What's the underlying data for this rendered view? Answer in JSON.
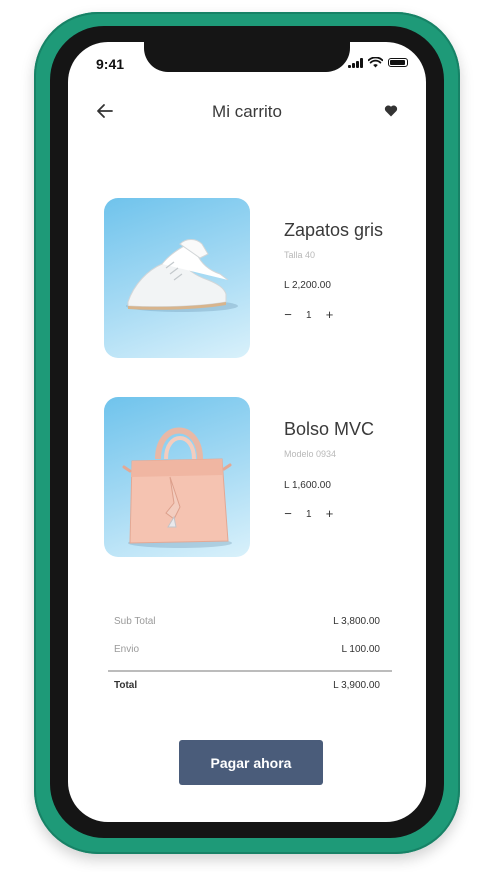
{
  "status_bar": {
    "time": "9:41"
  },
  "header": {
    "title": "Mi carrito",
    "back_icon": "arrow-left-icon",
    "fav_icon": "heart-icon"
  },
  "cart": {
    "items": [
      {
        "name": "Zapatos gris",
        "detail": "Talla 40",
        "price": "L 2,200.00",
        "quantity": "1",
        "image": "sneaker-image"
      },
      {
        "name": "Bolso MVC",
        "detail": "Modelo 0934",
        "price": "L 1,600.00",
        "quantity": "1",
        "image": "handbag-image"
      }
    ],
    "qty_minus": "−",
    "qty_plus": "+"
  },
  "summary": {
    "subtotal_label": "Sub Total",
    "subtotal_value": "L 3,800.00",
    "shipping_label": "Envio",
    "shipping_value": "L 100.00",
    "total_label": "Total",
    "total_value": "L 3,900.00"
  },
  "checkout": {
    "button_label": "Pagar ahora"
  },
  "colors": {
    "phone_frame": "#1e9a78",
    "button": "#4a5c7a",
    "image_bg": "#8fd0f0"
  }
}
